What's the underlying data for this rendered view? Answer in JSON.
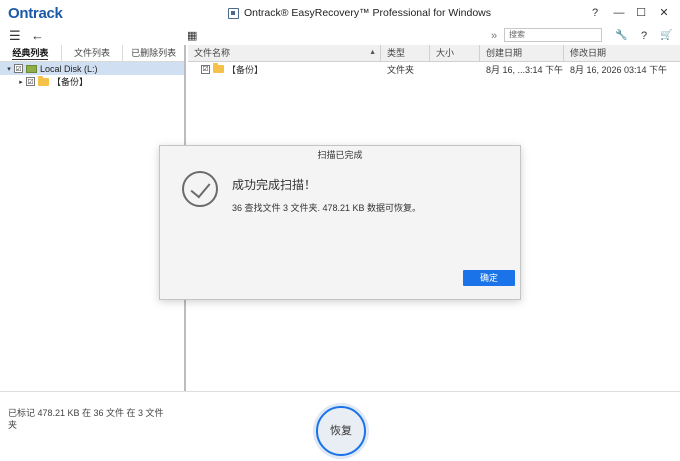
{
  "app": {
    "logo": "Ontrack",
    "title": "Ontrack® EasyRecovery™ Professional for Windows"
  },
  "window_controls": {
    "help": "?",
    "minimize": "—",
    "maximize": "☐",
    "close": "✕"
  },
  "toolbar": {
    "menu_icon": "☰",
    "back_icon": "←",
    "view_icon": "▦",
    "expand_icon": "»",
    "search_placeholder": "搜索",
    "tools_icon": "🔧",
    "help_icon": "?",
    "cart_icon": "🛒"
  },
  "left_tabs": [
    "经典列表",
    "文件列表",
    "已删除列表"
  ],
  "tree": [
    {
      "label": "Local Disk (L:)",
      "toggle": "▾",
      "check": "☑"
    },
    {
      "label": "【备份】",
      "toggle": "▸",
      "check": "☑"
    }
  ],
  "grid": {
    "columns": [
      "文件名称",
      "类型",
      "大小",
      "创建日期",
      "修改日期"
    ],
    "sort_indicator": "▲",
    "rows": [
      {
        "name": "【备份】",
        "type": "文件夹",
        "size": "",
        "created": "8月 16, ...3:14 下午",
        "modified": "8月 16, 2026 03:14 下午",
        "check": "☑"
      }
    ]
  },
  "dialog": {
    "title": "扫描已完成",
    "headline": "成功完成扫描！",
    "message": "36 查找文件 3 文件夹. 478.21 KB 数据可恢复。",
    "ok_label": "确定"
  },
  "status": {
    "text": "已标记 478.21 KB 在 36 文件 在 3 文件夹",
    "recover_label": "恢复"
  },
  "colors": {
    "accent": "#1a73e8",
    "brand": "#1c5aa8",
    "folder": "#f5c148"
  }
}
